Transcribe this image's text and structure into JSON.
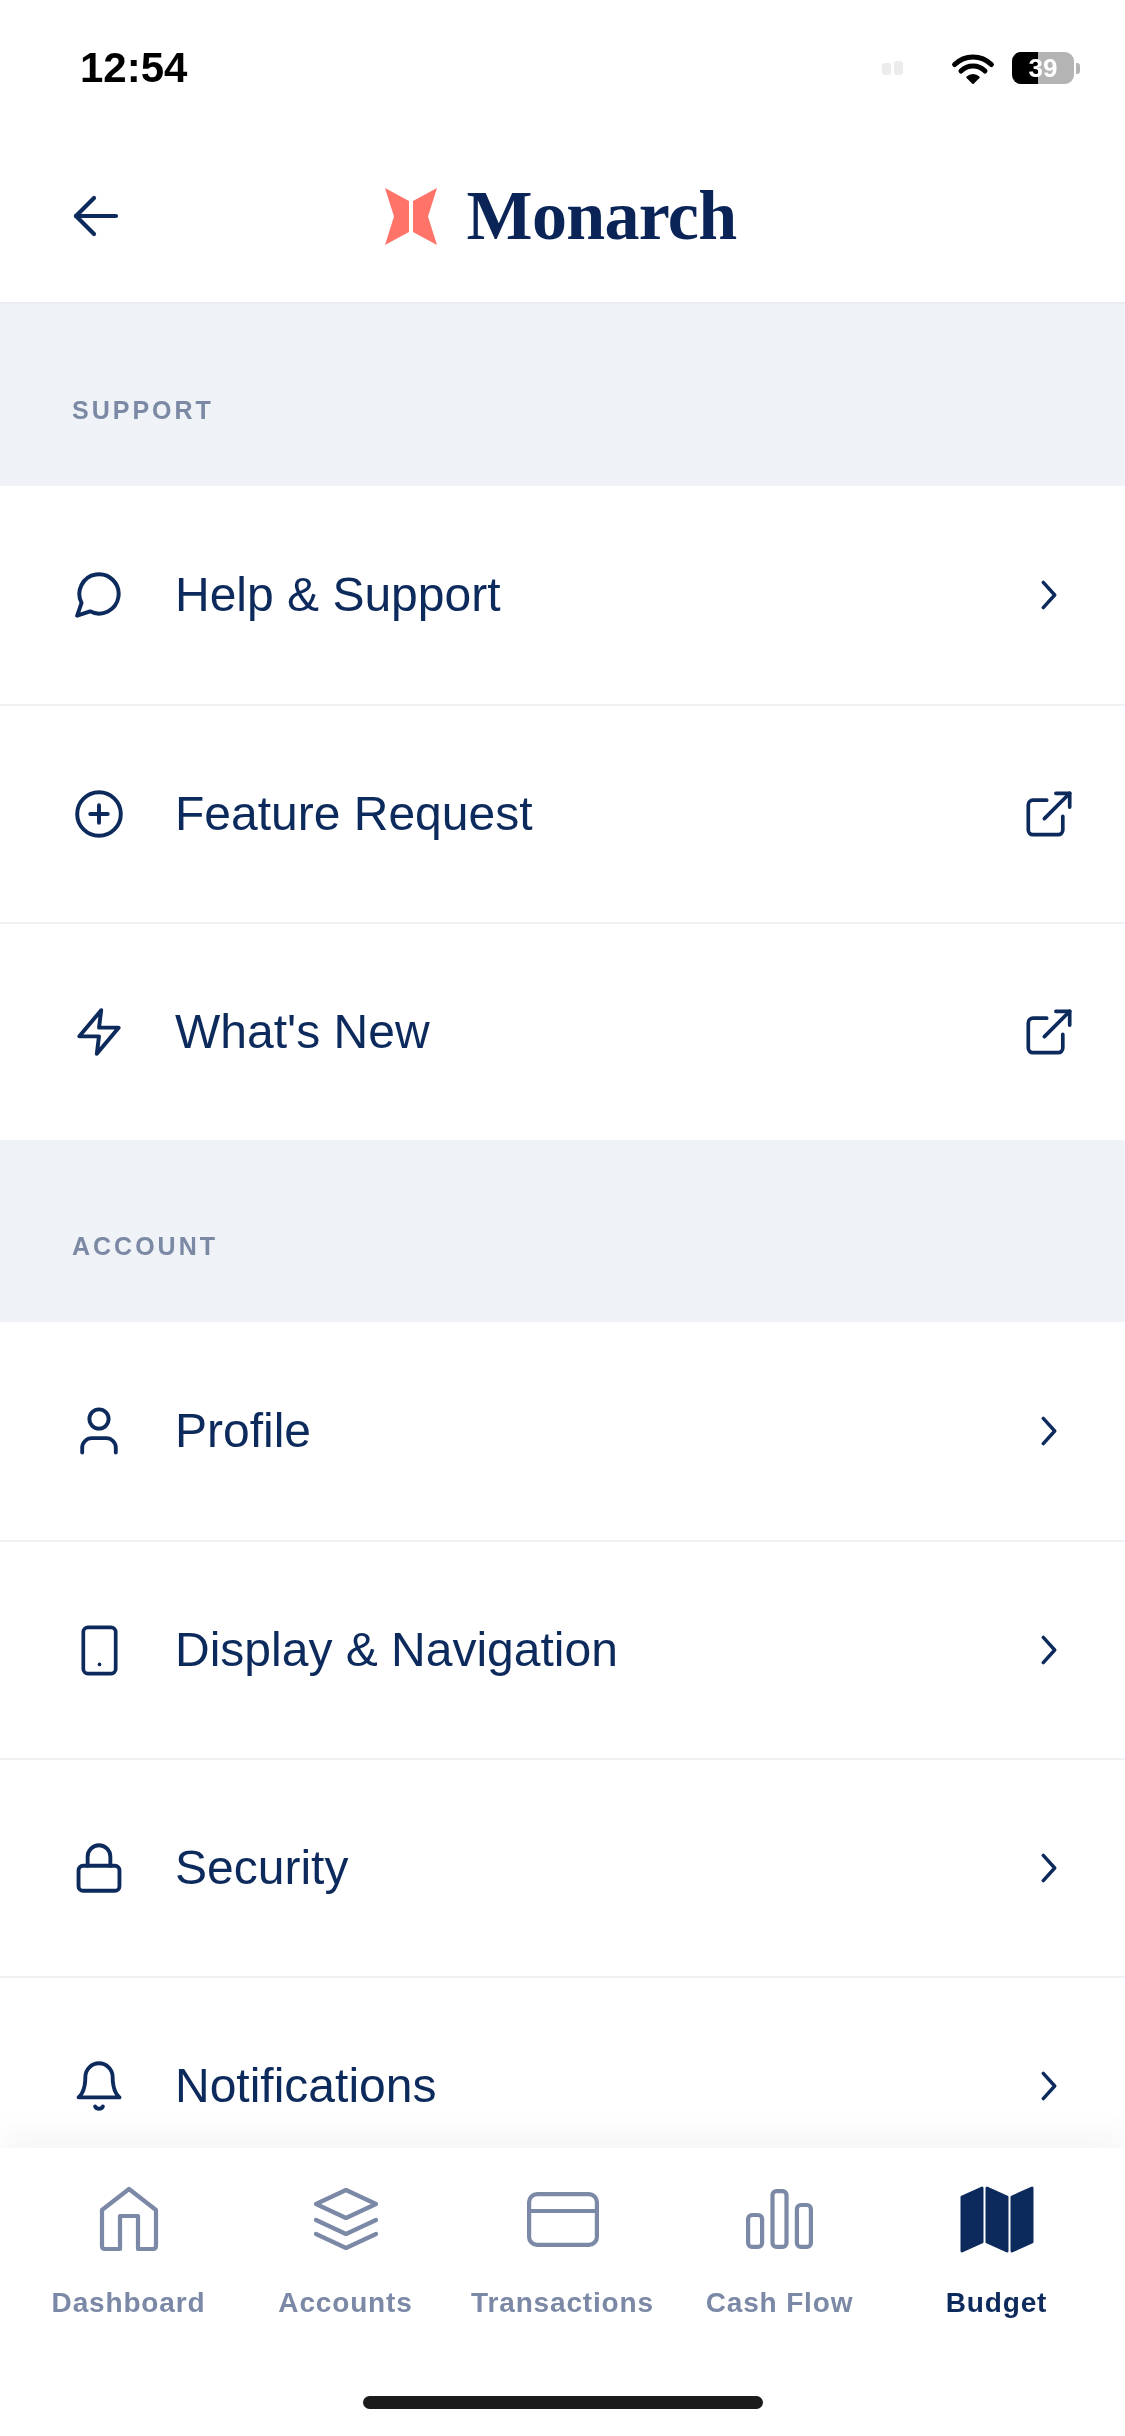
{
  "status_bar": {
    "time": "12:54",
    "battery": "39"
  },
  "header": {
    "title": "Monarch"
  },
  "sections": [
    {
      "title": "SUPPORT",
      "items": [
        {
          "label": "Help & Support",
          "kind": "link"
        },
        {
          "label": "Feature Request",
          "kind": "external"
        },
        {
          "label": "What's New",
          "kind": "external"
        }
      ]
    },
    {
      "title": "ACCOUNT",
      "items": [
        {
          "label": "Profile",
          "kind": "link"
        },
        {
          "label": "Display & Navigation",
          "kind": "link"
        },
        {
          "label": "Security",
          "kind": "link"
        },
        {
          "label": "Notifications",
          "kind": "link"
        }
      ]
    }
  ],
  "tab_bar": [
    {
      "label": "Dashboard",
      "selected": false
    },
    {
      "label": "Accounts",
      "selected": false
    },
    {
      "label": "Transactions",
      "selected": false
    },
    {
      "label": "Cash Flow",
      "selected": false
    },
    {
      "label": "Budget",
      "selected": true
    }
  ]
}
